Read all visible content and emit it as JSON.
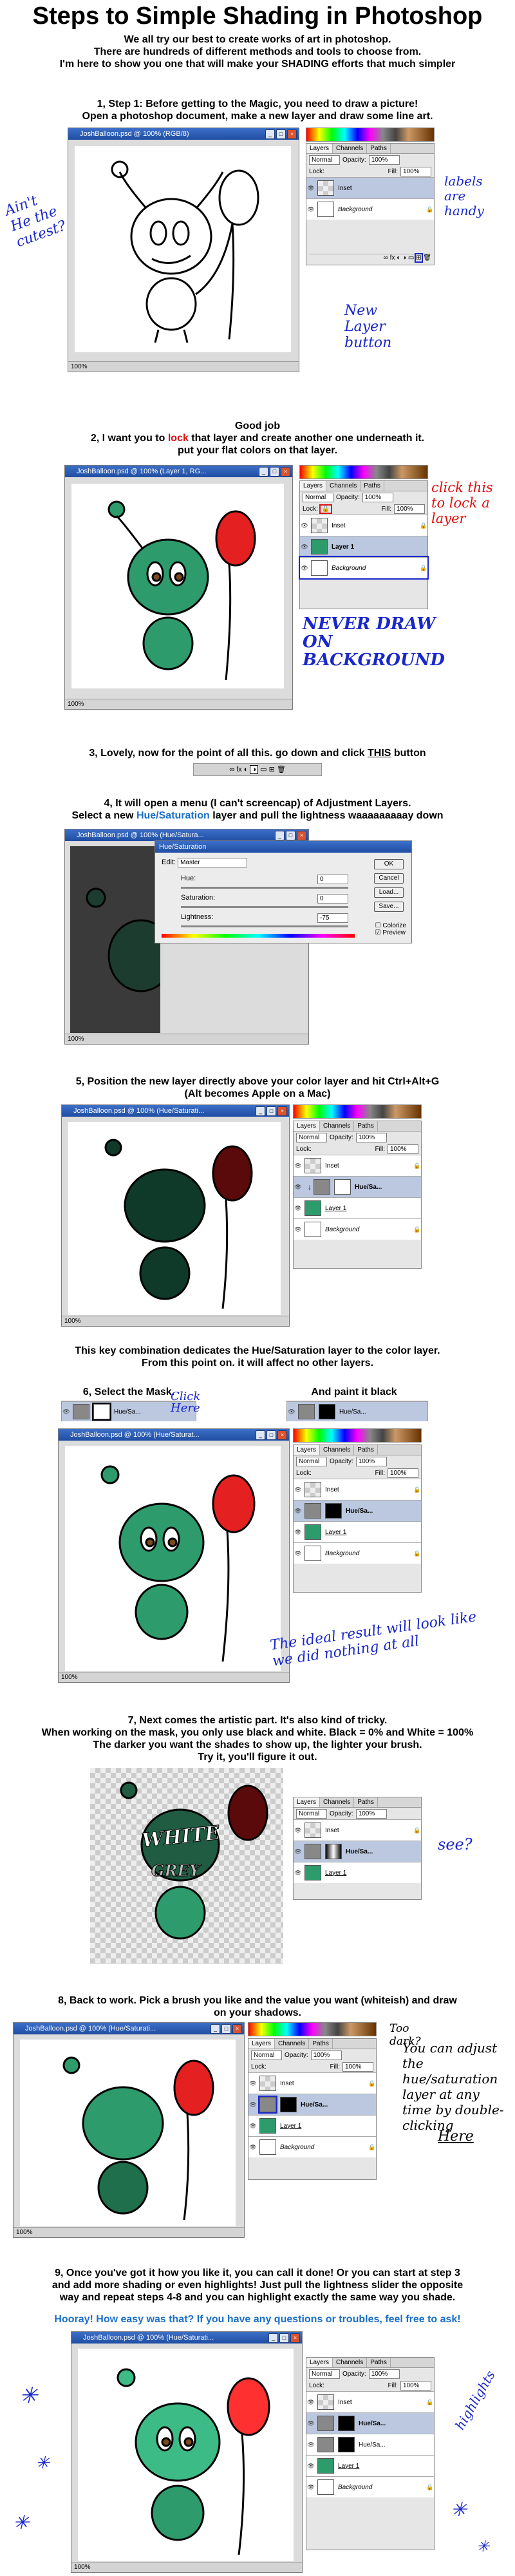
{
  "title": "Steps to Simple Shading in Photoshop",
  "intro": [
    "We all try our best to create works of art in photoshop.",
    "There are hundreds of different methods and tools to choose from.",
    "I'm here to show you one that will make your SHADING efforts that much simpler"
  ],
  "steps": {
    "s1": [
      "1, Step 1: Before getting to the Magic, you need to draw a picture!",
      "Open a photoshop document, make a new layer and draw some line art."
    ],
    "s2_head": "Good job",
    "s2": {
      "pre": "2, I want you to ",
      "lock_word": "lock",
      "post": " that layer and create another one underneath it.",
      "line2": "put your flat colors on that layer."
    },
    "s3": {
      "pre": "3, Lovely, now for the point of all this.  go down and click ",
      "this_word": "THIS",
      "post": " button"
    },
    "s4": {
      "line1": "4, It will open a menu (I can't screencap) of Adjustment Layers.",
      "pre": "Select a new ",
      "link": "Hue/Saturation",
      "post": " layer and pull the lightness waaaaaaaaay down"
    },
    "s5": [
      "5, Position the new layer directly above your color layer and hit Ctrl+Alt+G",
      "(Alt becomes Apple on a Mac)"
    ],
    "s5b": [
      "This key combination dedicates the Hue/Saturation layer to the color layer.",
      "From this point on. it will affect no other layers."
    ],
    "s6a": "6, Select the Mask.",
    "s6b": "And paint it black",
    "s7": [
      "7, Next comes the artistic part.  It's also kind of tricky.",
      "When working on the mask, you only use black and white.  Black = 0% and White = 100%",
      "The darker you want the shades to show up, the lighter your brush.",
      "Try it, you'll figure it out."
    ],
    "s8": [
      "8, Back to work.  Pick a brush you like and the value you want (whiteish) and draw",
      "on your shadows."
    ],
    "s9": [
      "9, Once you've got it how you like it, you can call it done!  Or you can start at step 3",
      "and add more shading or even highlights!  Just pull the lightness slider the opposite",
      "way and repeat steps 4-8 and you can highlight exactly the same way you shade."
    ],
    "outro": "Hooray!  How easy was that?  If you have any questions or troubles, feel free to ask!"
  },
  "windows": {
    "w1": "JoshBalloon.psd @ 100% (RGB/8)",
    "w2": "JoshBalloon.psd @ 100% (Layer 1, RG...",
    "w4": "JoshBalloon.psd @ 100% (Hue/Satura...",
    "w5": "JoshBalloon.psd @ 100% (Hue/Saturati...",
    "w6": "JoshBalloon.psd @ 100% (Hue/Saturat...",
    "w8": "JoshBalloon.psd @ 100% (Hue/Saturati...",
    "w9": "JoshBalloon.psd @ 100% (Hue/Saturati...",
    "zoom": "100%"
  },
  "panel": {
    "tabs": [
      "Layers",
      "Channels",
      "Paths"
    ],
    "mode": "Normal",
    "opacity_label": "Opacity:",
    "opacity": "100%",
    "fill_label": "Fill:",
    "fill": "100%",
    "lock_label": "Lock:",
    "layers": {
      "inset": "Inset",
      "layer1": "Layer 1",
      "background": "Background",
      "huesat": "Hue/Sa..."
    }
  },
  "dialog": {
    "title": "Hue/Saturation",
    "edit_label": "Edit:",
    "edit_value": "Master",
    "hue_label": "Hue:",
    "hue": "0",
    "sat_label": "Saturation:",
    "sat": "0",
    "light_label": "Lightness:",
    "light": "-75",
    "ok": "OK",
    "cancel": "Cancel",
    "load": "Load...",
    "save": "Save...",
    "colorize": "Colorize",
    "preview": "Preview"
  },
  "notes": {
    "cutest": "Ain't He the cutest?",
    "labels": "labels are handy",
    "new_layer": "New Layer button",
    "lock_note": "click this to lock a layer",
    "never": "NEVER DRAW ON BACKGROUND",
    "click_here": "Click Here",
    "ideal": "The ideal result will look like we did nothing at all",
    "white": "WHITE",
    "grey": "GREY",
    "see": "see?",
    "too_dark": "Too dark?",
    "adjust": "You can adjust the hue/saturation layer at any time by double-clicking",
    "here": "Here",
    "highlights": "highlights"
  }
}
